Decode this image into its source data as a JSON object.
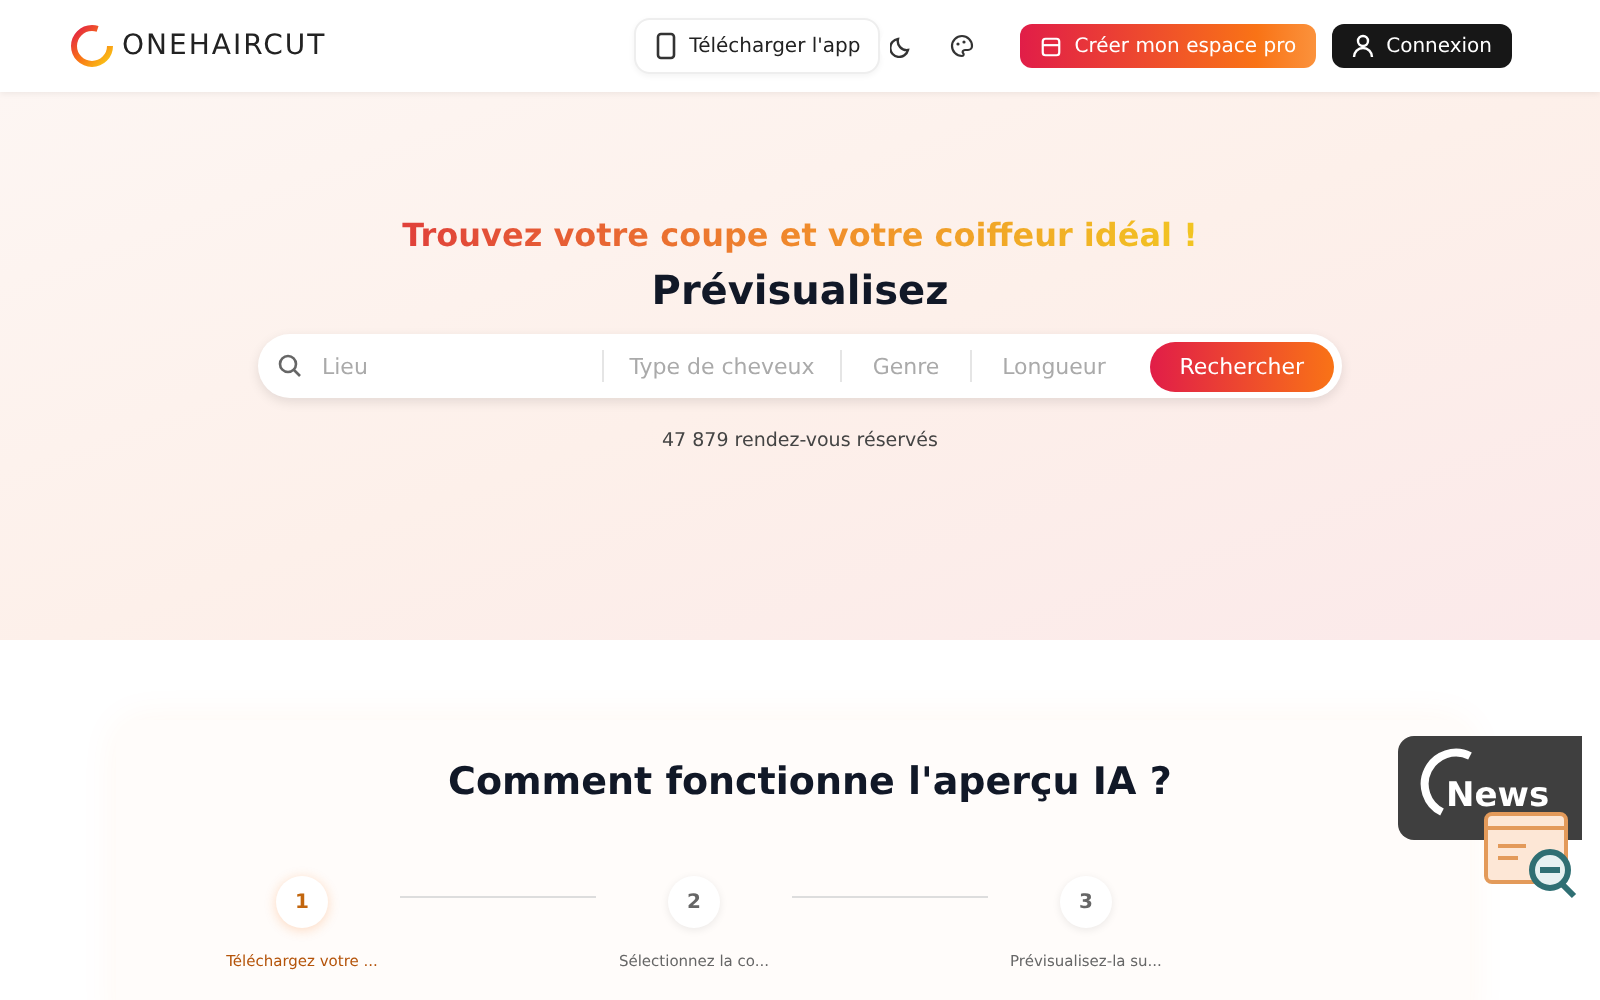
{
  "header": {
    "logo_text": "ONEHAIRCUT",
    "download_button": "Télécharger l'app",
    "pro_button": "Créer mon espace pro",
    "login_button": "Connexion"
  },
  "hero": {
    "tagline": "Trouvez votre coupe et votre coiffeur idéal !",
    "title": "Prévisualisez",
    "search": {
      "fields": [
        {
          "placeholder": "Lieu",
          "kind": "location"
        },
        {
          "placeholder": "Type de cheveux",
          "kind": "select"
        },
        {
          "placeholder": "Genre",
          "kind": "select"
        },
        {
          "placeholder": "Longueur",
          "kind": "select"
        }
      ],
      "button": "Rechercher"
    },
    "count": "47 879 rendez-vous réservés"
  },
  "how_it_works": {
    "title": "Comment fonctionne l'aperçu IA ?",
    "steps": [
      {
        "number": "1",
        "label": "Téléchargez votre ...",
        "selected": true
      },
      {
        "number": "2",
        "label": "Sélectionnez la co...",
        "selected": false
      },
      {
        "number": "3",
        "label": "Prévisualisez-la su...",
        "selected": false
      }
    ]
  },
  "news_badge": {
    "label": "News"
  }
}
